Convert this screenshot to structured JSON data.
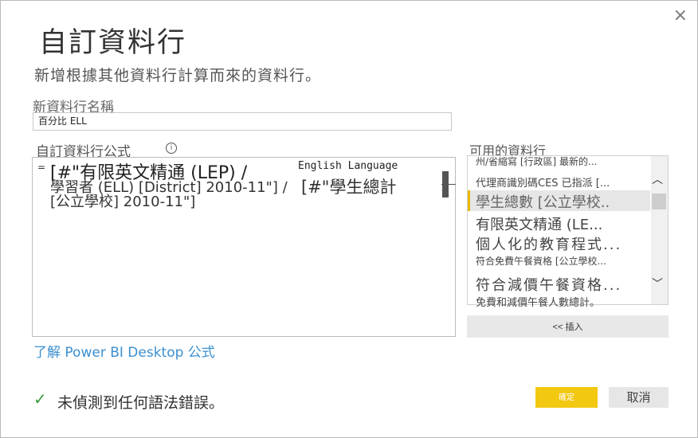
{
  "dialog": {
    "title": "自訂資料行",
    "subtitle": "新增根據其他資料行計算而來的資料行。",
    "close_icon": "×"
  },
  "name_field": {
    "label": "新資料行名稱",
    "value": "百分比 ELL"
  },
  "formula": {
    "label": "自訂資料行公式",
    "info_icon": "i",
    "equals": "=",
    "line1": "[#\"有限英文精通 (LEP) /",
    "line2": "學習者 (ELL) [District] 2010-11\"] /",
    "line3": "[公立學校] 2010-11\"]",
    "english_overlay": "English Language",
    "student_overlay": "[#\"學生總計"
  },
  "learn_link": "了解 Power BI Desktop 公式",
  "available_columns": {
    "label": "可用的資料行",
    "items": [
      "州/省縮寫 [行政區] 最新的...",
      "代理商識別碼CES 已指派 [...",
      "學生總數 [公立學校..",
      "有限英文精通 (LE...",
      "個人化的教育程式...",
      "符合免費午餐資格 [公立學校...",
      "符合減價午餐資格...",
      "免費和減價午餐人數總計。"
    ],
    "selected_index": 2,
    "scroll_up_icon": "︿",
    "scroll_down_icon": "﹀"
  },
  "insert_button": "<< 插入",
  "status": {
    "check_icon": "✓",
    "text": "未偵測到任何語法錯誤。"
  },
  "buttons": {
    "ok": "確定",
    "cancel": "取消"
  },
  "colors": {
    "accent": "#f2c811",
    "link": "#3b8fd0",
    "success": "#3a9a3a"
  }
}
